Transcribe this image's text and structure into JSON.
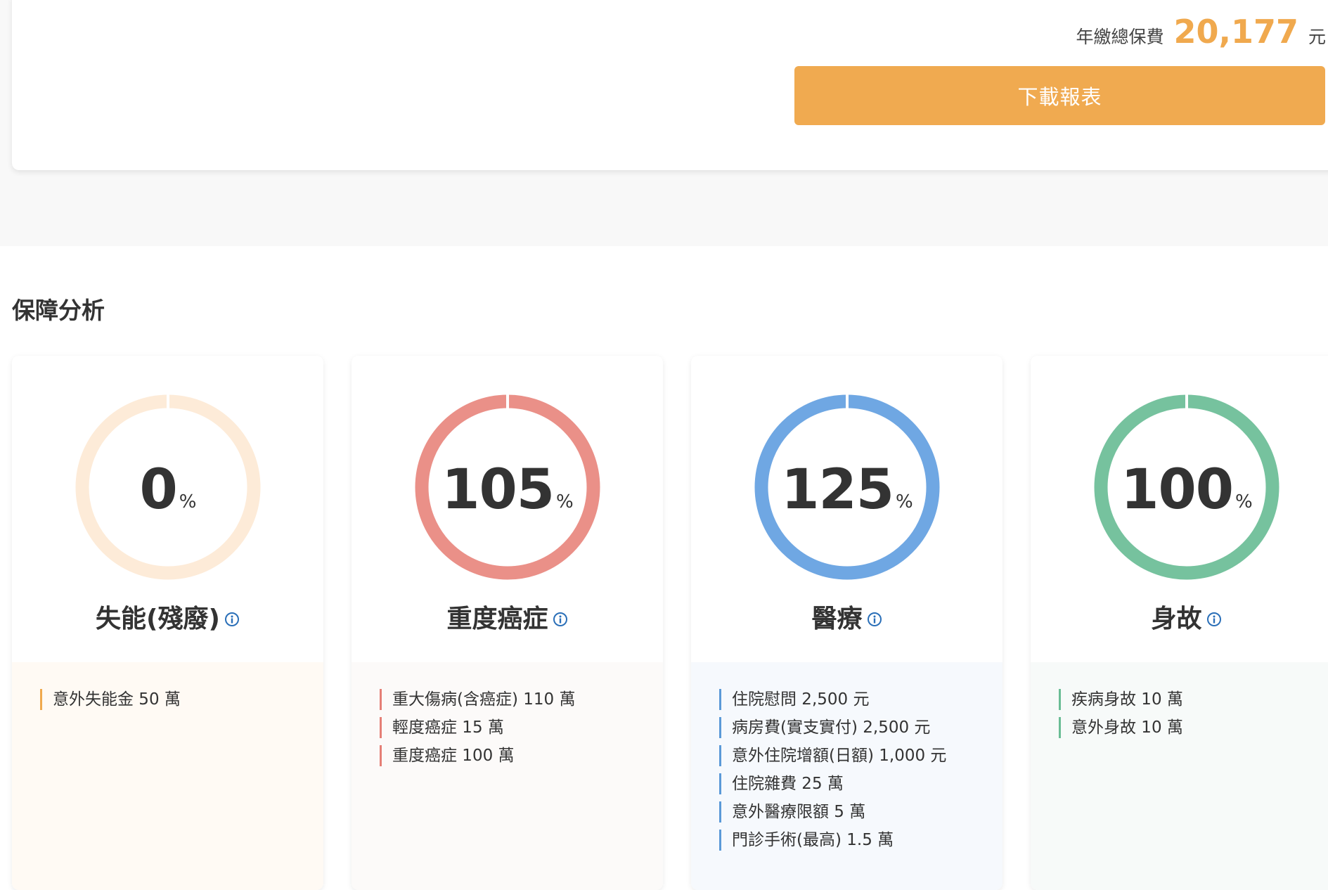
{
  "premium": {
    "label": "年繳總保費",
    "amount": "20,177",
    "unit": "元",
    "download_label": "下載報表",
    "accent_color": "#f0a94e"
  },
  "section": {
    "title": "保障分析"
  },
  "cards": [
    {
      "title": "失能(殘廢)",
      "value": "0",
      "percent_sign": "%",
      "coverage_ratio": 0,
      "ring_color": "#fdebd8",
      "track_color": "#fdebd8",
      "bar_color": "#f0a94e",
      "bottom_bg": "#fffaf4",
      "info_icon": "info-circle-icon",
      "items": [
        "意外失能金 50 萬"
      ]
    },
    {
      "title": "重度癌症",
      "value": "105",
      "percent_sign": "%",
      "coverage_ratio": 1.05,
      "ring_color": "#ea9088",
      "track_color": "#ea9088",
      "bar_color": "#e57f76",
      "bottom_bg": "#fcfaf9",
      "info_icon": "info-circle-icon",
      "items": [
        "重大傷病(含癌症) 110 萬",
        "輕度癌症 15 萬",
        "重度癌症 100 萬"
      ]
    },
    {
      "title": "醫療",
      "value": "125",
      "percent_sign": "%",
      "coverage_ratio": 1.25,
      "ring_color": "#6fa7e3",
      "track_color": "#6fa7e3",
      "bar_color": "#5b9ad8",
      "bottom_bg": "#f6f9fd",
      "info_icon": "info-circle-icon",
      "items": [
        "住院慰問 2,500 元",
        "病房費(實支實付) 2,500 元",
        "意外住院增額(日額) 1,000 元",
        "住院雜費 25 萬",
        "意外醫療限額 5 萬",
        "門診手術(最高) 1.5 萬"
      ]
    },
    {
      "title": "身故",
      "value": "100",
      "percent_sign": "%",
      "coverage_ratio": 1.0,
      "ring_color": "#76c29e",
      "track_color": "#76c29e",
      "bar_color": "#6abd95",
      "bottom_bg": "#f7faf9",
      "info_icon": "info-circle-icon",
      "items": [
        "疾病身故 10 萬",
        "意外身故 10 萬"
      ]
    }
  ]
}
